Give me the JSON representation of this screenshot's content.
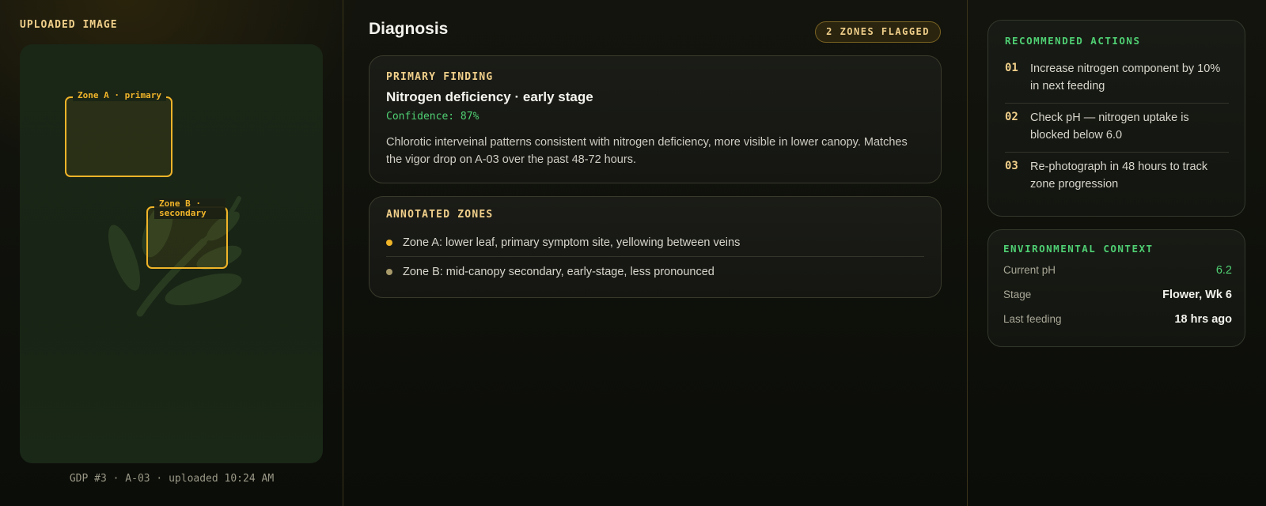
{
  "upload": {
    "title": "UPLOADED IMAGE",
    "caption": "GDP #3 · A-03 · uploaded 10:24 AM",
    "zones": [
      {
        "label": "Zone A · primary"
      },
      {
        "label": "Zone B ·\nsecondary"
      }
    ],
    "zone_color": "#f0b429"
  },
  "diagnosis": {
    "title": "Diagnosis",
    "badge": "2 ZONES FLAGGED",
    "finding": {
      "label": "PRIMARY FINDING",
      "title": "Nitrogen deficiency · early stage",
      "confidence": "Confidence: 87%",
      "description": "Chlorotic interveinal patterns consistent with nitrogen deficiency, more visible in lower canopy. Matches the vigor drop on A-03 over the past 48-72 hours."
    },
    "zones": {
      "label": "ANNOTATED ZONES",
      "items": [
        {
          "text": "Zone A: lower leaf, primary symptom site, yellowing between veins",
          "color": "#f0b429"
        },
        {
          "text": "Zone B: mid-canopy secondary, early-stage, less pronounced",
          "color": "#a89a6a"
        }
      ]
    }
  },
  "actions": {
    "label": "RECOMMENDED ACTIONS",
    "items": [
      {
        "num": "01",
        "text": "Increase nitrogen component by 10% in next feeding"
      },
      {
        "num": "02",
        "text": "Check pH — nitrogen uptake is blocked below 6.0"
      },
      {
        "num": "03",
        "text": "Re-photograph in 48 hours to track zone progression"
      }
    ]
  },
  "environment": {
    "label": "ENVIRONMENTAL CONTEXT",
    "rows": [
      {
        "key": "Current pH",
        "value": "6.2"
      },
      {
        "key": "Stage",
        "value": "Flower, Wk 6"
      },
      {
        "key": "Last feeding",
        "value": "18 hrs ago"
      }
    ]
  },
  "colors": {
    "accent_gold": "#f0cf8a",
    "accent_green": "#4fcf73"
  }
}
